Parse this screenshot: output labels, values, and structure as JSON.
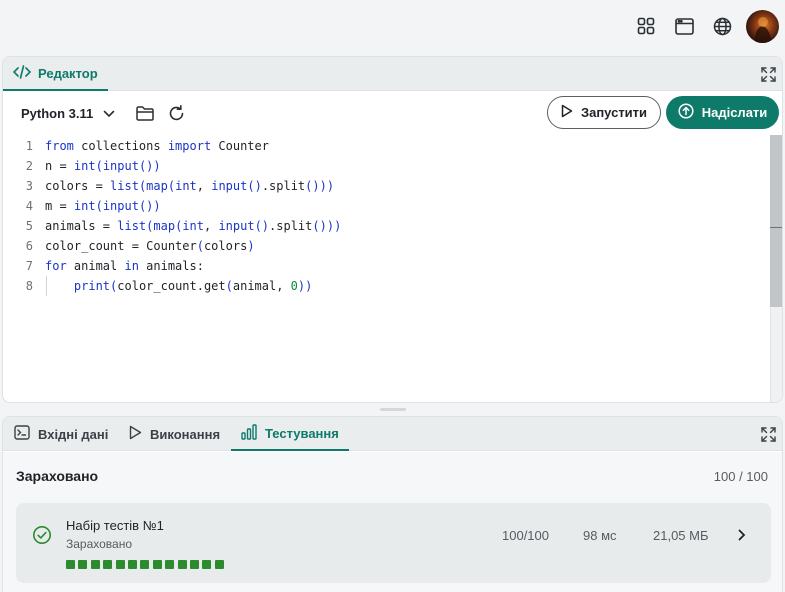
{
  "topbar": {
    "icons": [
      "apps-grid-icon",
      "browser-window-icon",
      "globe-icon"
    ]
  },
  "editor": {
    "tab_label": "Редактор",
    "language": "Python 3.11",
    "run_label": "Запустити",
    "submit_label": "Надіслати",
    "lines": [
      {
        "n": "1",
        "html": "<span class=\"kw\">from</span> collections <span class=\"kw\">import</span> Counter"
      },
      {
        "n": "2",
        "html": "n = <span class=\"fn\">int</span><span class=\"pn\">(</span><span class=\"fn\">input</span><span class=\"pn\">())</span>"
      },
      {
        "n": "3",
        "html": "colors = <span class=\"fn\">list</span><span class=\"pn\">(</span><span class=\"fn\">map</span><span class=\"pn\">(</span><span class=\"fn\">int</span>, <span class=\"fn\">input</span><span class=\"pn\">()</span>.split<span class=\"pn\">()))</span>"
      },
      {
        "n": "4",
        "html": "m = <span class=\"fn\">int</span><span class=\"pn\">(</span><span class=\"fn\">input</span><span class=\"pn\">())</span>"
      },
      {
        "n": "5",
        "html": "animals = <span class=\"fn\">list</span><span class=\"pn\">(</span><span class=\"fn\">map</span><span class=\"pn\">(</span><span class=\"fn\">int</span>, <span class=\"fn\">input</span><span class=\"pn\">()</span>.split<span class=\"pn\">()))</span>"
      },
      {
        "n": "6",
        "html": "color_count = Counter<span class=\"pn\">(</span>colors<span class=\"pn\">)</span>"
      },
      {
        "n": "7",
        "html": "<span class=\"kw\">for</span> animal <span class=\"kw\">in</span> animals:"
      },
      {
        "n": "8",
        "html": "    <span class=\"fn\">print</span><span class=\"pn\">(</span>color_count.get<span class=\"pn\">(</span>animal, <span class=\"num\">0</span><span class=\"pn\">))</span>"
      }
    ]
  },
  "bottom": {
    "tabs": [
      {
        "label": "Вхідні дані",
        "icon": "terminal-icon"
      },
      {
        "label": "Виконання",
        "icon": "play-icon"
      },
      {
        "label": "Тестування",
        "icon": "bar-chart-icon"
      }
    ],
    "active_tab": 2,
    "result_title": "Зараховано",
    "result_score": "100 / 100",
    "testset": {
      "name": "Набір тестів №1",
      "status": "Зараховано",
      "score": "100/100",
      "time": "98 мс",
      "memory": "21,05 МБ",
      "passed_tests": 13
    }
  },
  "colors": {
    "accent": "#0d7a6a",
    "success": "#2e8a2e"
  }
}
